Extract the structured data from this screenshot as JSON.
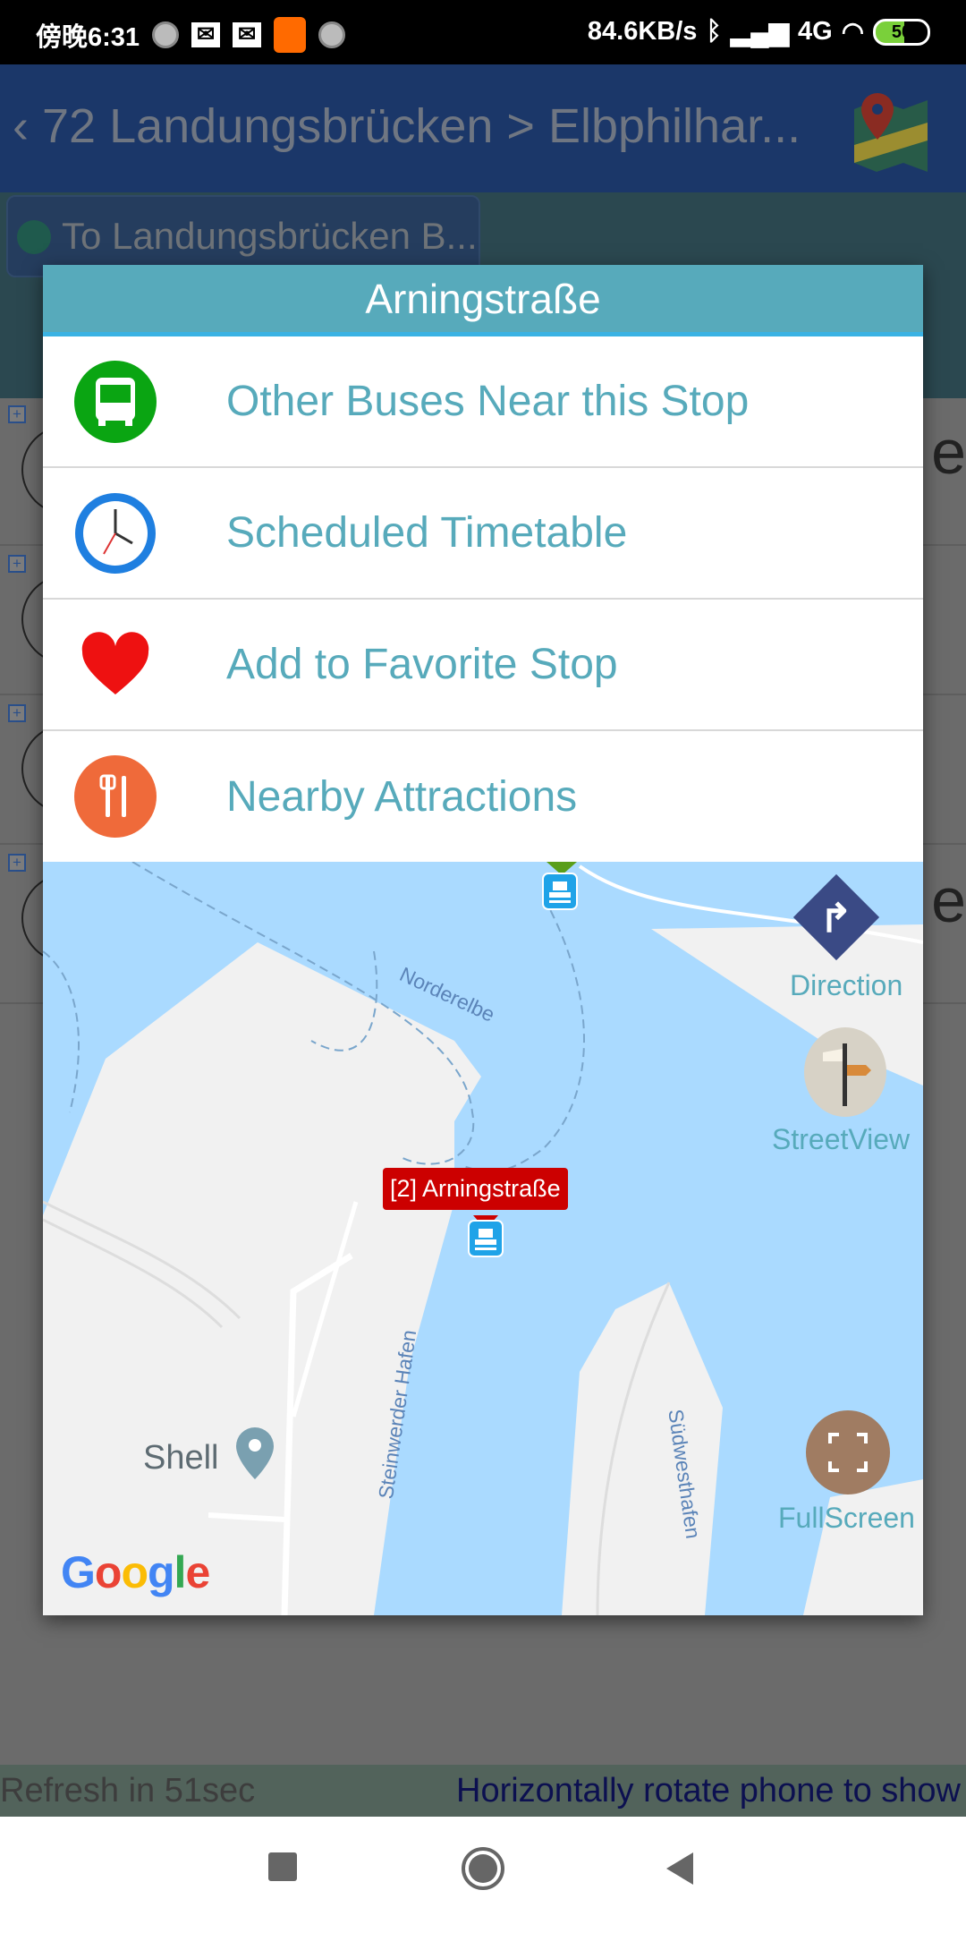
{
  "status_bar": {
    "time": "傍晚6:31",
    "network_speed": "84.6KB/s",
    "network_type": "4G",
    "battery": "50",
    "mi_icon": "mi"
  },
  "header": {
    "title": "72 Landungsbrücken > Elbphilhar...",
    "back_icon": "chevron-left-icon",
    "map_icon": "google-maps-icon"
  },
  "tab": {
    "label": "To Landungsbrücken B..."
  },
  "background_rows": [
    {
      "trailing": "e"
    },
    {
      "trailing": ""
    },
    {
      "trailing": ""
    },
    {
      "trailing": "e"
    }
  ],
  "dialog": {
    "title": "Arningstraße",
    "items": [
      {
        "label": "Other Buses Near this Stop",
        "icon": "bus-icon"
      },
      {
        "label": "Scheduled Timetable",
        "icon": "clock-icon"
      },
      {
        "label": "Add to Favorite Stop",
        "icon": "heart-icon"
      },
      {
        "label": "Nearby Attractions",
        "icon": "restaurant-icon"
      }
    ]
  },
  "map": {
    "marker_label": "[2] Arningstraße",
    "water_labels": [
      "Norderelbe",
      "Steinwerder Hafen",
      "Südwesthafen"
    ],
    "poi": "Shell",
    "logo": "Google",
    "controls": {
      "direction": "Direction",
      "streetview": "StreetView",
      "fullscreen": "FullScreen"
    }
  },
  "bottom_bar": {
    "refresh": "Refresh in 51sec",
    "hint": "Horizontally rotate phone to show"
  },
  "colors": {
    "accent": "#57aabb",
    "marker": "#cc0000",
    "water": "#aadaff",
    "land": "#f1f1f1"
  }
}
